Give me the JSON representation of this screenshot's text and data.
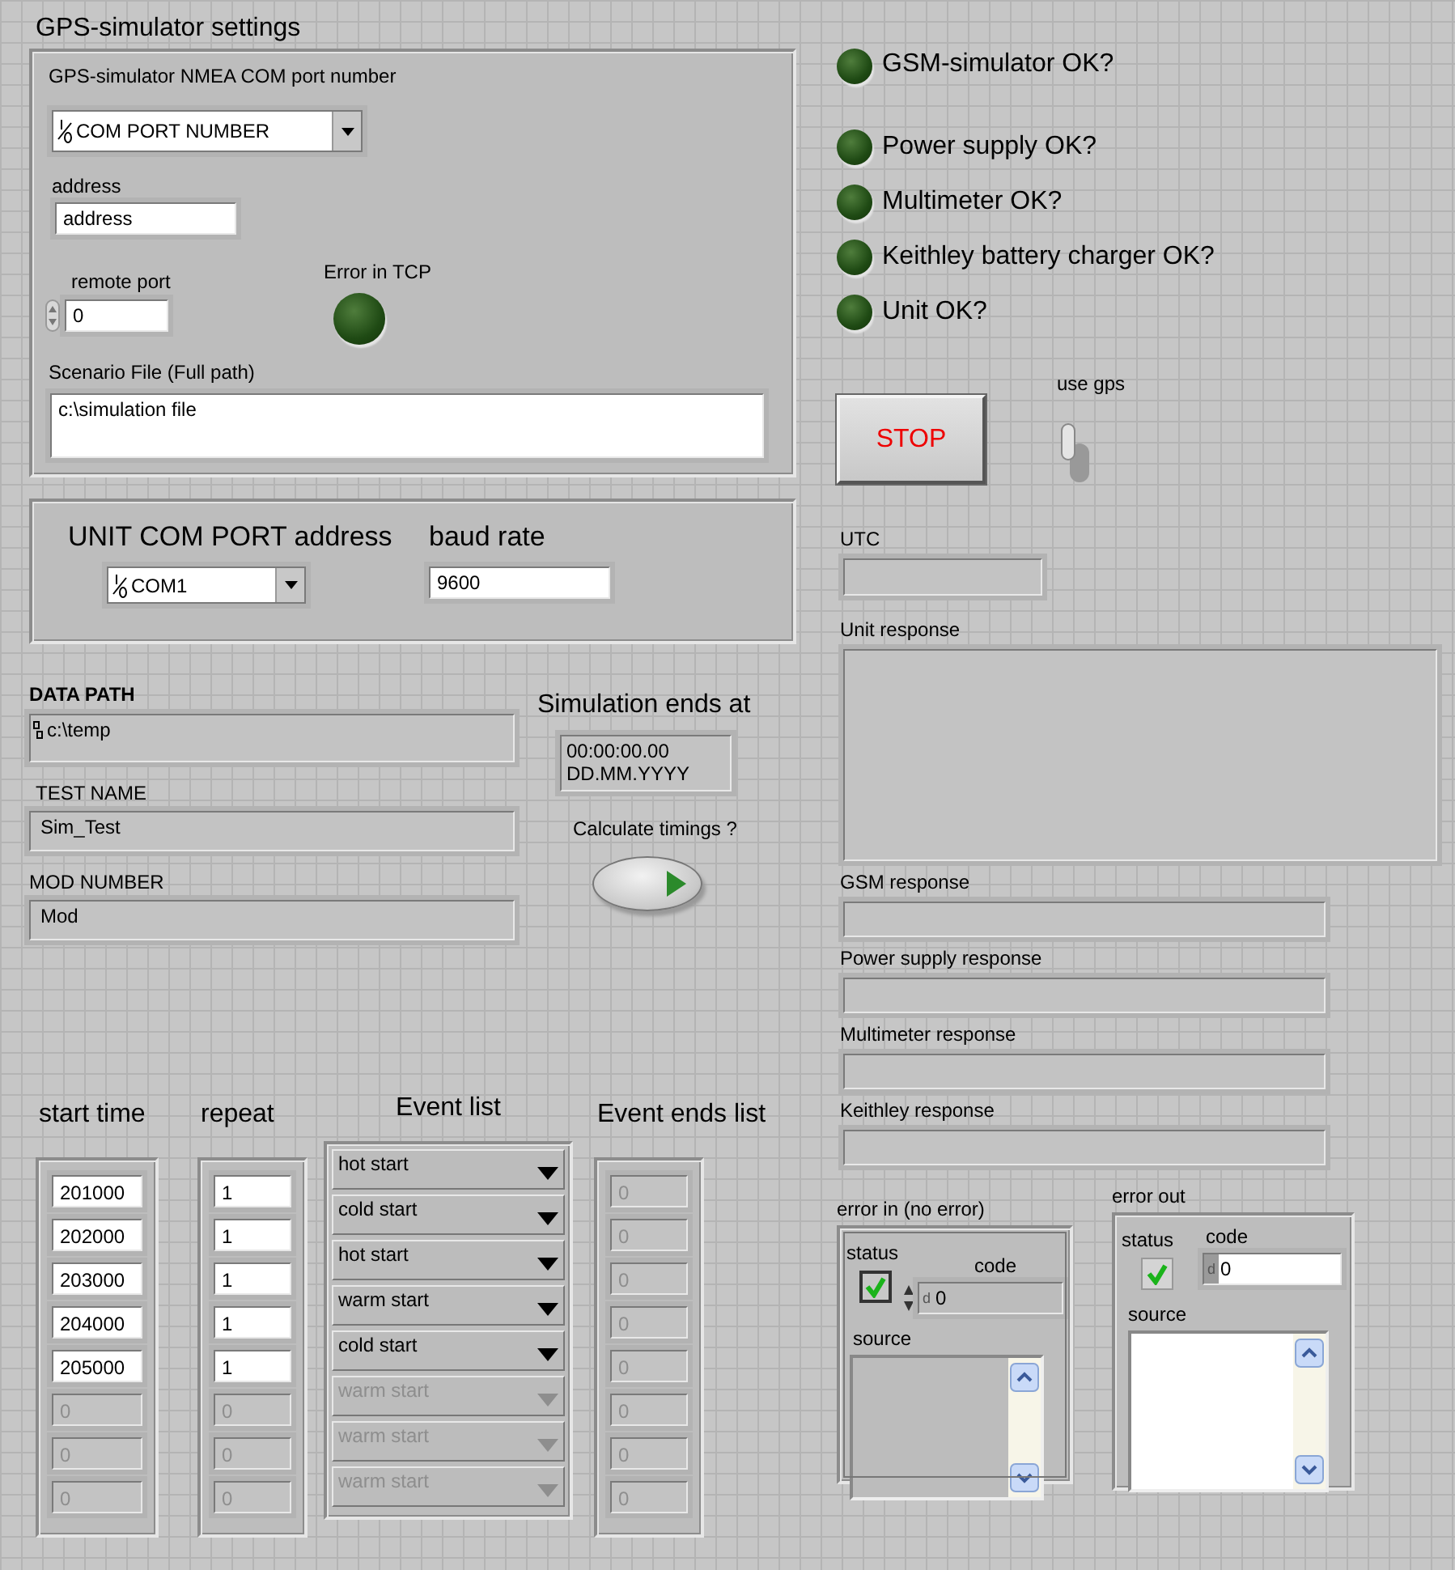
{
  "gps_settings": {
    "title": "GPS-simulator settings",
    "com_port": {
      "label": "GPS-simulator NMEA COM port number",
      "value": "COM PORT NUMBER"
    },
    "address": {
      "label": "address",
      "value": "address"
    },
    "remote_port": {
      "label": "remote port",
      "value": "0"
    },
    "error_in_tcp": {
      "label": "Error in TCP",
      "on": false
    },
    "scenario_file": {
      "label": "Scenario File (Full path)",
      "value": "c:\\simulation file"
    }
  },
  "unit_com": {
    "label": "UNIT COM PORT address",
    "value": "COM1"
  },
  "baud_rate": {
    "label": "baud rate",
    "value": "9600"
  },
  "data_path": {
    "label": "DATA PATH",
    "value": "c:\\temp"
  },
  "test_name": {
    "label": "TEST NAME",
    "value": "Sim_Test"
  },
  "mod_number": {
    "label": "MOD NUMBER",
    "value": "Mod"
  },
  "simulation_ends": {
    "label": "Simulation ends at",
    "time": "00:00:00.00",
    "date": "DD.MM.YYYY"
  },
  "calculate_timings": {
    "label": "Calculate timings ?",
    "on": false
  },
  "event_table": {
    "columns": [
      {
        "label": "start time",
        "kind": "numeric",
        "items": [
          {
            "value": "201000",
            "disabled": false
          },
          {
            "value": "202000",
            "disabled": false
          },
          {
            "value": "203000",
            "disabled": false
          },
          {
            "value": "204000",
            "disabled": false
          },
          {
            "value": "205000",
            "disabled": false
          },
          {
            "value": "0",
            "disabled": true
          },
          {
            "value": "0",
            "disabled": true
          },
          {
            "value": "0",
            "disabled": true
          }
        ]
      },
      {
        "label": "repeat",
        "kind": "numeric",
        "items": [
          {
            "value": "1",
            "disabled": false
          },
          {
            "value": "1",
            "disabled": false
          },
          {
            "value": "1",
            "disabled": false
          },
          {
            "value": "1",
            "disabled": false
          },
          {
            "value": "1",
            "disabled": false
          },
          {
            "value": "0",
            "disabled": true
          },
          {
            "value": "0",
            "disabled": true
          },
          {
            "value": "0",
            "disabled": true
          }
        ]
      },
      {
        "label": "Event list",
        "kind": "enum",
        "items": [
          {
            "value": "hot start",
            "disabled": false
          },
          {
            "value": "cold start",
            "disabled": false
          },
          {
            "value": "hot start",
            "disabled": false
          },
          {
            "value": "warm start",
            "disabled": false
          },
          {
            "value": "cold start",
            "disabled": false
          },
          {
            "value": "warm start",
            "disabled": true
          },
          {
            "value": "warm start",
            "disabled": true
          },
          {
            "value": "warm start",
            "disabled": true
          }
        ]
      },
      {
        "label": "Event ends list",
        "kind": "numeric",
        "items": [
          {
            "value": "0",
            "disabled": true
          },
          {
            "value": "0",
            "disabled": true
          },
          {
            "value": "0",
            "disabled": true
          },
          {
            "value": "0",
            "disabled": true
          },
          {
            "value": "0",
            "disabled": true
          },
          {
            "value": "0",
            "disabled": true
          },
          {
            "value": "0",
            "disabled": true
          },
          {
            "value": "0",
            "disabled": true
          }
        ]
      }
    ]
  },
  "status_leds": [
    {
      "label": "GSM-simulator OK?",
      "on": false
    },
    {
      "label": "Power supply OK?",
      "on": false
    },
    {
      "label": "Multimeter OK?",
      "on": false
    },
    {
      "label": "Keithley battery charger OK?",
      "on": false
    },
    {
      "label": "Unit OK?",
      "on": false
    }
  ],
  "stop_button": {
    "label": "STOP"
  },
  "use_gps": {
    "label": "use gps",
    "on": false
  },
  "indicators": [
    {
      "label": "UTC",
      "kind": "short"
    },
    {
      "label": "Unit response",
      "kind": "multiline"
    },
    {
      "label": "GSM response",
      "kind": "line"
    },
    {
      "label": "Power supply response",
      "kind": "line"
    },
    {
      "label": "Multimeter response",
      "kind": "line"
    },
    {
      "label": "Keithley response",
      "kind": "line"
    }
  ],
  "error_in": {
    "title": "error in (no error)",
    "kind": "control",
    "disabled": true,
    "status_label": "status",
    "status": true,
    "code_label": "code",
    "radix": "d",
    "code": "0",
    "source_label": "source"
  },
  "error_out": {
    "title": "error out",
    "kind": "indicator",
    "disabled": false,
    "status_label": "status",
    "status": true,
    "code_label": "code",
    "radix": "d",
    "code": "0",
    "source_label": "source"
  }
}
